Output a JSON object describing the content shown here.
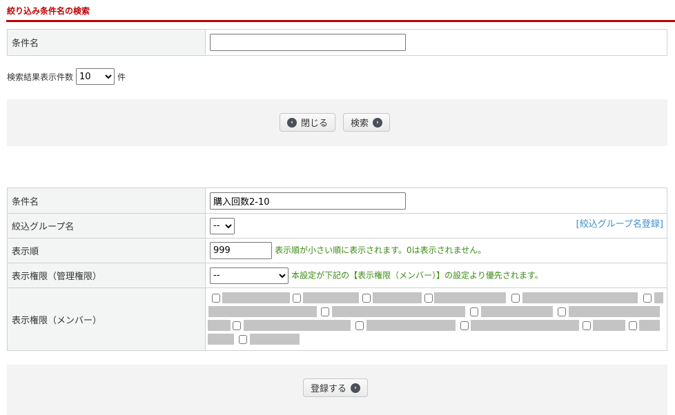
{
  "search": {
    "title": "絞り込み条件名の検索",
    "condition_label": "条件名",
    "condition_value": "",
    "result_count_label": "検索結果表示件数",
    "result_count_value": "10",
    "result_count_unit": "件",
    "close_button": "閉じる",
    "search_button": "検索"
  },
  "form": {
    "condition_label": "条件名",
    "condition_value": "購入回数2-10",
    "group_label": "絞込グループ名",
    "group_value": "--",
    "group_register_link": "絞込グループ名登録",
    "order_label": "表示順",
    "order_value": "999",
    "order_note": "表示順が小さい順に表示されます。0は表示されません。",
    "admin_perm_label": "表示権限（管理権限）",
    "admin_perm_value": "--",
    "admin_perm_note": "本設定が下記の【表示権限（メンバー）】の設定より優先されます。",
    "member_perm_label": "表示権限（メンバー）",
    "register_button": "登録する"
  },
  "colors": {
    "accent": "#c00000",
    "note": "#3a8a12",
    "link": "#3a8fd0"
  }
}
